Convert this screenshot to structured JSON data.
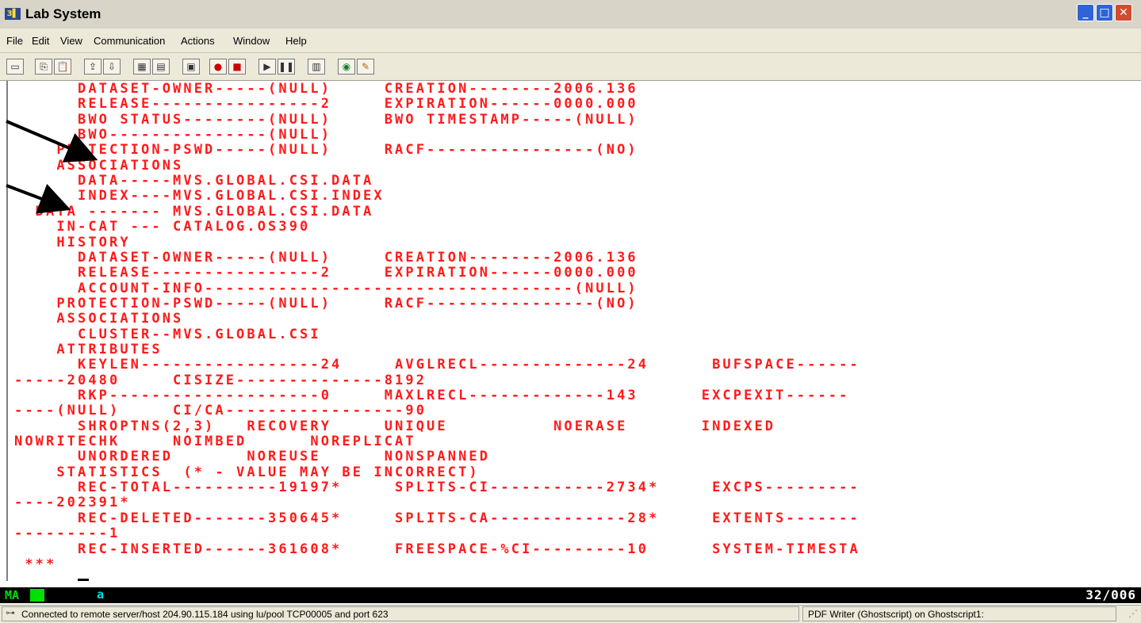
{
  "window": {
    "title": "Lab System",
    "app_icon": "terminal-app-icon"
  },
  "menu": [
    "File",
    "Edit",
    "View",
    "Communication",
    "Actions",
    "Window",
    "Help"
  ],
  "toolbar_icons": [
    "display-icon",
    "copy-icon",
    "paste-icon",
    "send-icon",
    "receive-icon",
    "screen-icon",
    "screen-alt-icon",
    "macro-icon",
    "record-icon",
    "stop-icon",
    "play-icon",
    "pause-icon",
    "clipboard-icon",
    "globe-icon",
    "edit-icon"
  ],
  "terminal": {
    "lines": [
      "      DATASET-OWNER-----(NULL)     CREATION--------2006.136",
      "      RELEASE----------------2     EXPIRATION------0000.000",
      "      BWO STATUS--------(NULL)     BWO TIMESTAMP-----(NULL)",
      "      BWO---------------(NULL)",
      "    PROTECTION-PSWD-----(NULL)     RACF----------------(NO)",
      "    ASSOCIATIONS",
      "      DATA-----MVS.GLOBAL.CSI.DATA",
      "      INDEX----MVS.GLOBAL.CSI.INDEX",
      "  DATA ------- MVS.GLOBAL.CSI.DATA",
      "    IN-CAT --- CATALOG.OS390",
      "    HISTORY",
      "      DATASET-OWNER-----(NULL)     CREATION--------2006.136",
      "      RELEASE----------------2     EXPIRATION------0000.000",
      "      ACCOUNT-INFO-----------------------------------(NULL)",
      "    PROTECTION-PSWD-----(NULL)     RACF----------------(NO)",
      "    ASSOCIATIONS",
      "      CLUSTER--MVS.GLOBAL.CSI",
      "    ATTRIBUTES",
      "      KEYLEN-----------------24     AVGLRECL--------------24      BUFSPACE------",
      "-----20480     CISIZE--------------8192",
      "      RKP--------------------0     MAXLRECL-------------143      EXCPEXIT------",
      "----(NULL)     CI/CA-----------------90",
      "      SHROPTNS(2,3)   RECOVERY     UNIQUE          NOERASE       INDEXED",
      "NOWRITECHK     NOIMBED      NOREPLICAT",
      "      UNORDERED       NOREUSE      NONSPANNED",
      "    STATISTICS  (* - VALUE MAY BE INCORRECT)",
      "      REC-TOTAL----------19197*     SPLITS-CI-----------2734*     EXCPS---------",
      "----202391*",
      "      REC-DELETED-------350645*     SPLITS-CA-------------28*     EXTENTS-------",
      "---------1",
      "      REC-INSERTED------361608*     FREESPACE-%CI---------10      SYSTEM-TIMESTA",
      " ***"
    ]
  },
  "oia": {
    "mode": "MA",
    "field": "a",
    "cursor_pos": "32/006"
  },
  "statusbar": {
    "connection": "Connected to remote server/host 204.90.115.184 using lu/pool TCP00005 and port 623",
    "printer": "PDF Writer (Ghostscript) on Ghostscript1:"
  },
  "colors": {
    "terminal_text": "#ff1a1a",
    "oia_bg": "#000000",
    "oia_green": "#00e000"
  }
}
